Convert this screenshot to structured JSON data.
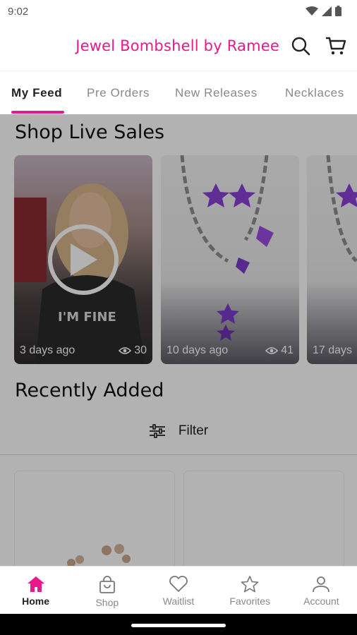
{
  "status_bar": {
    "time": "9:02"
  },
  "header": {
    "brand": "Jewel Bombshell by Ramee"
  },
  "tabs": [
    {
      "label": "My Feed",
      "active": true
    },
    {
      "label": "Pre Orders"
    },
    {
      "label": "New Releases"
    },
    {
      "label": "Necklaces"
    }
  ],
  "feed": {
    "live_title": "Shop Live Sales",
    "live_cards": [
      {
        "time": "3 days ago",
        "views": "30"
      },
      {
        "time": "10 days ago",
        "views": "41"
      },
      {
        "time": "17 days"
      }
    ],
    "recent_title": "Recently Added",
    "filter_label": "Filter"
  },
  "bottom_nav": [
    {
      "label": "Home",
      "icon": "home-icon",
      "active": true
    },
    {
      "label": "Shop",
      "icon": "shopping-bag-icon"
    },
    {
      "label": "Waitlist",
      "icon": "heart-icon"
    },
    {
      "label": "Favorites",
      "icon": "star-icon"
    },
    {
      "label": "Account",
      "icon": "person-icon"
    }
  ],
  "colors": {
    "accent": "#e8198b",
    "text": "#222222",
    "muted": "#888888"
  }
}
